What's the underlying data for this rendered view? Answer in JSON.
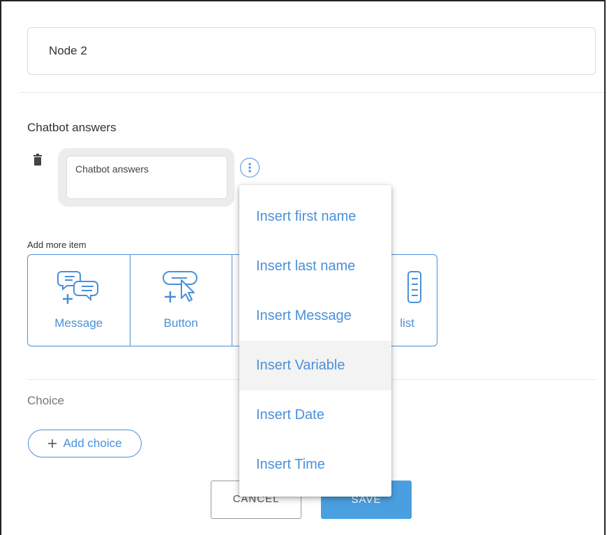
{
  "node": {
    "name": "Node 2"
  },
  "answers": {
    "section_label": "Chatbot answers",
    "input_placeholder": "Chatbot answers"
  },
  "add_more": {
    "label": "Add more item",
    "items": [
      {
        "label": "Message",
        "icon": "chat-bubbles-plus-icon"
      },
      {
        "label": "Button",
        "icon": "button-cursor-plus-icon"
      },
      {
        "label": "",
        "icon": "hidden-item-icon"
      },
      {
        "label": "list",
        "icon": "list-icon"
      }
    ]
  },
  "choice": {
    "label": "Choice",
    "add_label": "Add choice"
  },
  "footer": {
    "cancel_label": "CANCEL",
    "save_label": "SAVE"
  },
  "menu": {
    "items": [
      {
        "label": "Insert first name"
      },
      {
        "label": "Insert last name"
      },
      {
        "label": "Insert Message"
      },
      {
        "label": "Insert Variable",
        "active": true
      },
      {
        "label": "Insert Date"
      },
      {
        "label": "Insert Time"
      }
    ]
  },
  "colors": {
    "accent": "#4a90d9",
    "save": "#4a9fe0",
    "hover": "#f3f3f3"
  }
}
